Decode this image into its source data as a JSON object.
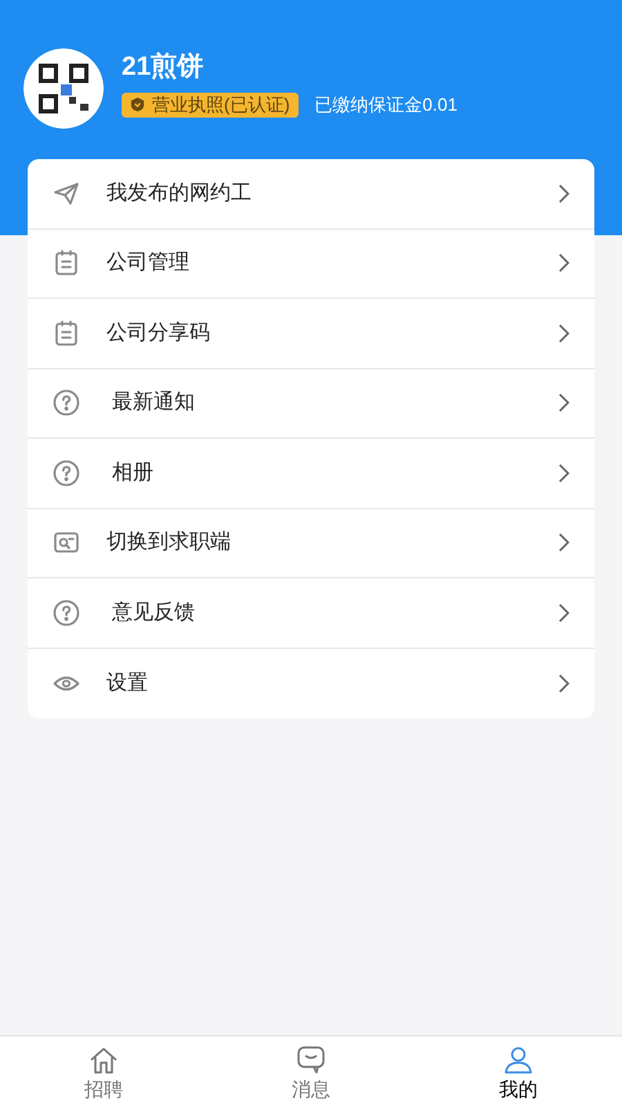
{
  "profile": {
    "name": "21煎饼",
    "badge": "营业执照(已认证)",
    "deposit": "已缴纳保证金0.01"
  },
  "menu": [
    {
      "label": "我发布的网约工",
      "kind": "send"
    },
    {
      "label": "公司管理",
      "kind": "note"
    },
    {
      "label": "公司分享码",
      "kind": "note"
    },
    {
      "label": "最新通知",
      "kind": "question"
    },
    {
      "label": "相册",
      "kind": "question"
    },
    {
      "label": "切换到求职端",
      "kind": "search"
    },
    {
      "label": "意见反馈",
      "kind": "question"
    },
    {
      "label": "设置",
      "kind": "eye"
    }
  ],
  "tab_bar": [
    {
      "label": "招聘",
      "kind": "home",
      "selected": false
    },
    {
      "label": "消息",
      "kind": "chat",
      "selected": false
    },
    {
      "label": "我的",
      "kind": "person",
      "selected": true
    }
  ]
}
